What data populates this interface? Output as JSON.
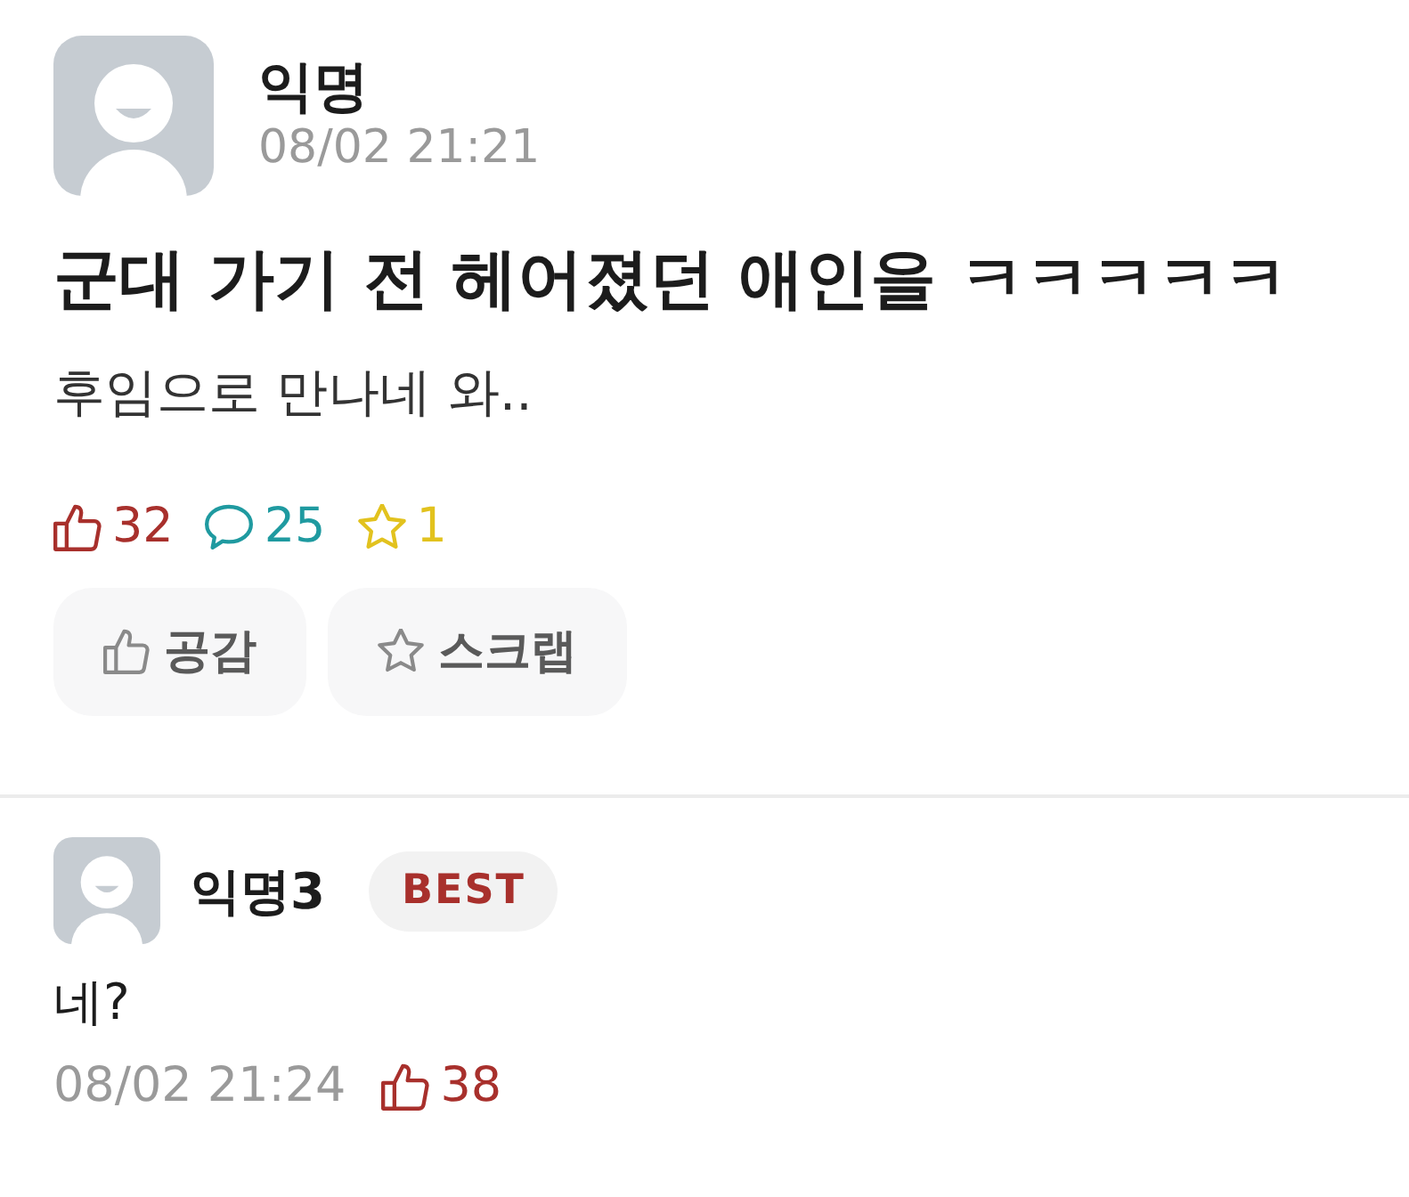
{
  "post": {
    "author": "익명",
    "timestamp": "08/02 21:21",
    "title": "군대 가기 전 헤어졌던 애인을 ㅋㅋㅋㅋㅋ",
    "body": "후임으로 만나네 와..",
    "stats": [
      {
        "kind": "likes",
        "count": "32"
      },
      {
        "kind": "comments",
        "count": "25"
      },
      {
        "kind": "scraps",
        "count": "1"
      }
    ],
    "actions": [
      {
        "kind": "like",
        "label": "공감"
      },
      {
        "kind": "scrap",
        "label": "스크랩"
      }
    ]
  },
  "comments": [
    {
      "author": "익명3",
      "badge": "BEST",
      "text": "네?",
      "timestamp": "08/02 21:24",
      "likes": "38"
    }
  ]
}
